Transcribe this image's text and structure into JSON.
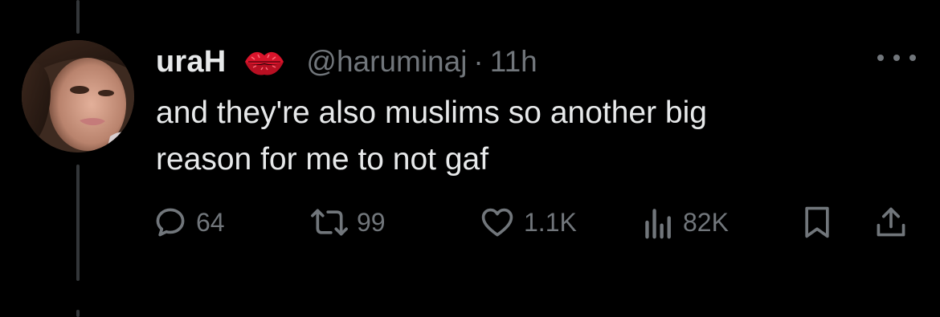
{
  "tweet": {
    "display_name": "uraH",
    "handle": "@haruminaj",
    "separator": "·",
    "time": "11h",
    "text_line1": "and they're also muslims so another big",
    "text_line2": "reason for me to not gaf",
    "emoji_icon": "kiss-lips-icon",
    "actions": {
      "reply_count": "64",
      "retweet_count": "99",
      "like_count": "1.1K",
      "views_count": "82K"
    }
  },
  "colors": {
    "background": "#000000",
    "primary_text": "#e7e9ea",
    "secondary_text": "#71767b",
    "thread_line": "#333639",
    "link_blue": "#1d9bf0",
    "lips_red": "#d9142b"
  }
}
